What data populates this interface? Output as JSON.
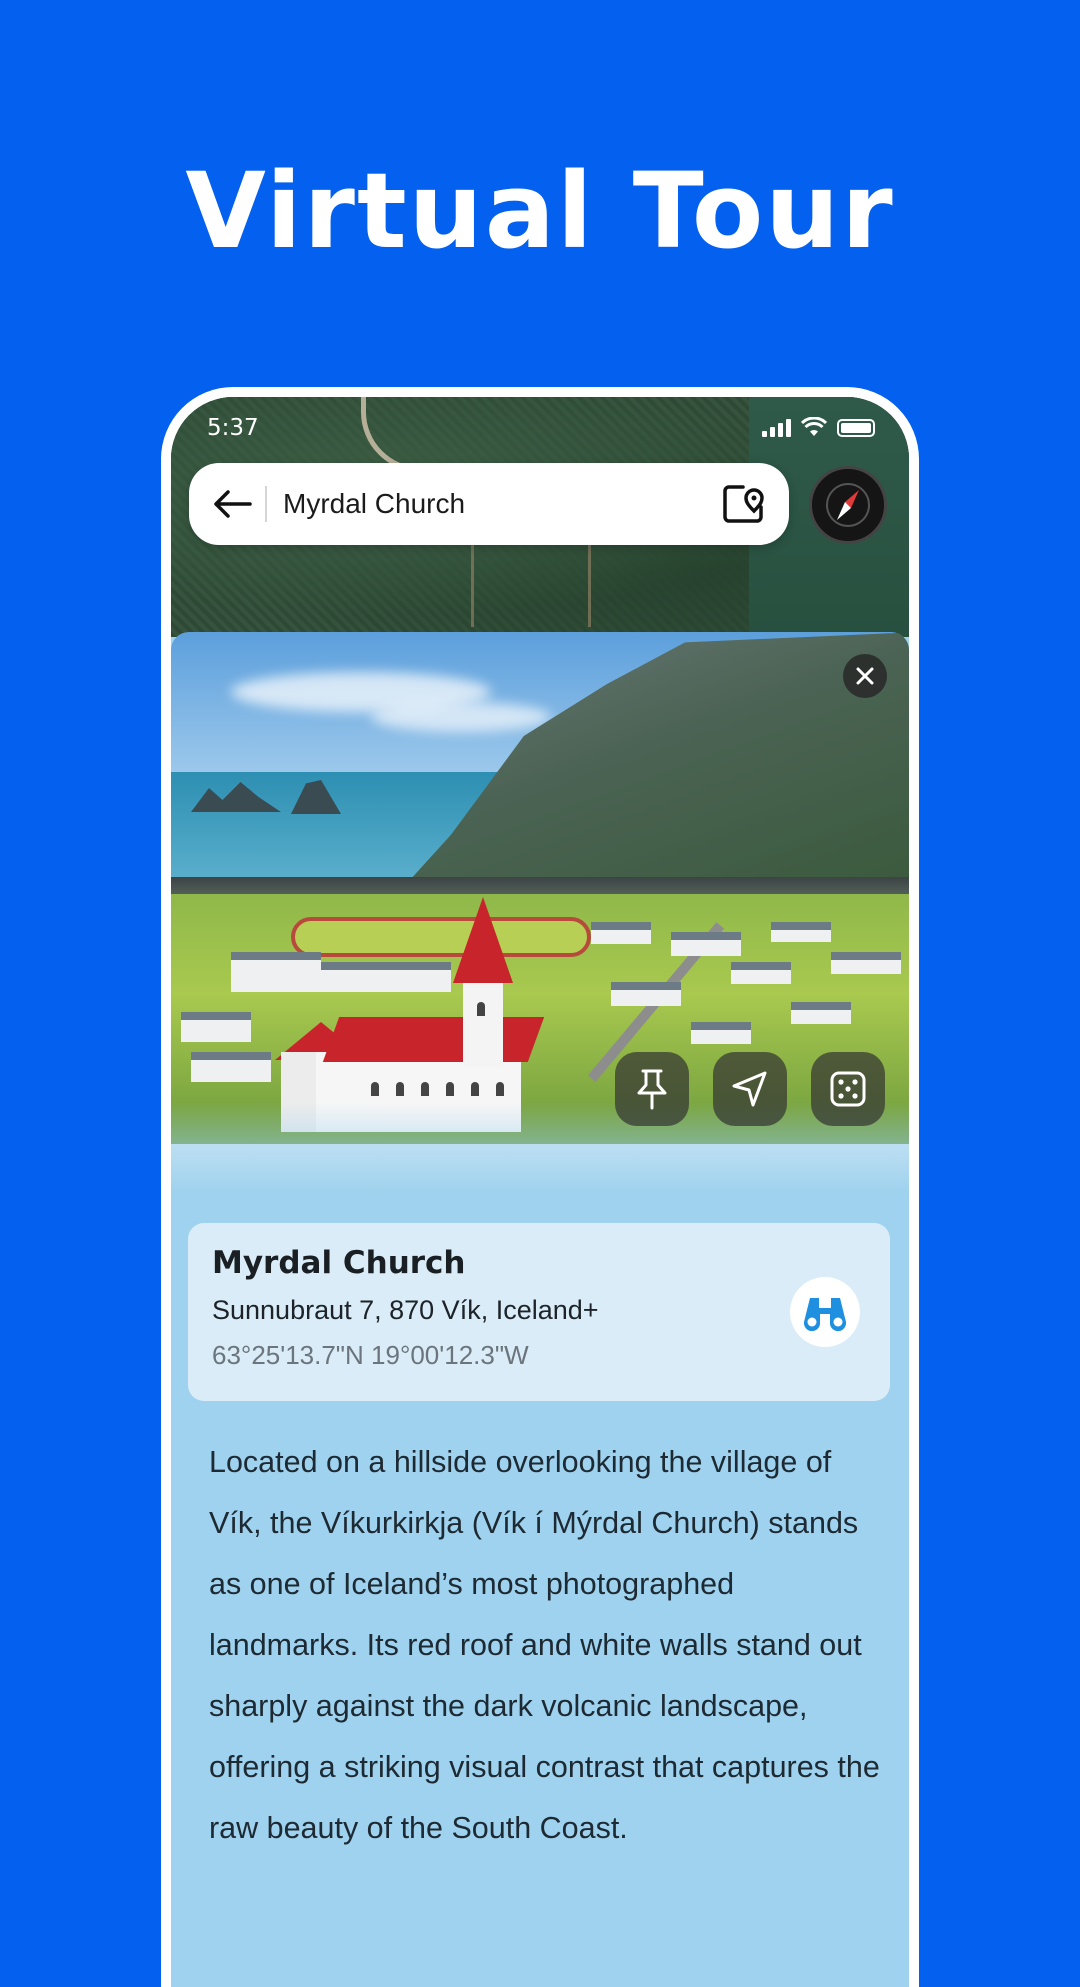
{
  "promo": {
    "title": "Virtual Tour"
  },
  "status_bar": {
    "time": "5:37"
  },
  "search": {
    "value": "Myrdal Church"
  },
  "place": {
    "name": "Myrdal Church",
    "address": "Sunnubraut 7, 870 Vík, Iceland+",
    "coordinates": "63°25'13.7\"N 19°00'12.3\"W",
    "description": "Located on a hillside overlooking the village of Vík, the Víkurkirkja (Vík í Mýrdal Church) stands as one of Iceland’s most photographed landmarks. Its red roof and white walls stand out sharply against the dark volcanic landscape, offering a striking visual contrast that captures the raw beauty of the South Coast."
  },
  "icons": {
    "back": "arrow-left-icon",
    "map_pin": "map-pin-icon",
    "compass": "compass-icon",
    "close": "close-icon",
    "pin": "pushpin-icon",
    "navigate": "navigation-arrow-icon",
    "random": "dice-icon",
    "binoculars": "binoculars-icon"
  },
  "colors": {
    "background": "#0460ee",
    "panel": "#9fd2ee",
    "card": "#d9ecf7",
    "accent": "#1f8fe0",
    "church_roof": "#c8242b"
  }
}
